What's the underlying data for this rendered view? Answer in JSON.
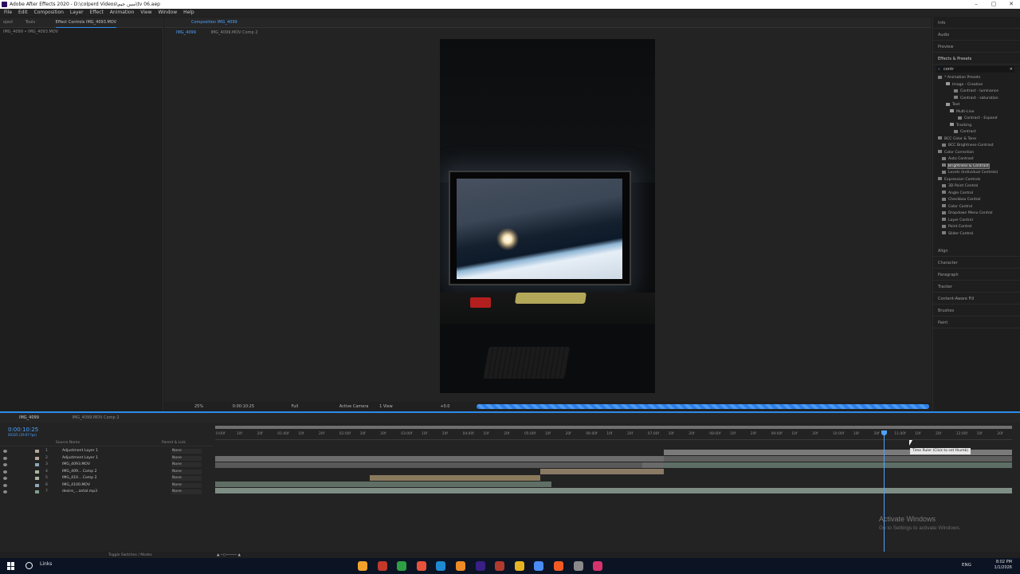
{
  "window": {
    "title": "Adobe After Effects 2020 - D:\\colperd Videos\\سين جيم\\tv 06.aep"
  },
  "menu": [
    "File",
    "Edit",
    "Composition",
    "Layer",
    "Effect",
    "Animation",
    "View",
    "Window",
    "Help"
  ],
  "left_panel": {
    "tabs": [
      "oject",
      "Tools",
      "Effect Controls IMG_4093.MOV"
    ],
    "subtitle": "IMG_4099 • IMG_4093.MOV"
  },
  "composition": {
    "tab": "Composition IMG_4099",
    "sub_tabs": [
      "IMG_4099",
      "IMG_4099.MOV Comp 2"
    ],
    "bottom": {
      "zoom": "25%",
      "time": "0:00:10:25",
      "resolution": "Full",
      "camera": "Active Camera",
      "view": "1 View",
      "exposure": "+0.0"
    }
  },
  "right_panel": {
    "panels_top": [
      "Info",
      "Audio",
      "Preview"
    ],
    "effects_title": "Effects & Presets",
    "search": "contr",
    "effects": [
      {
        "indent": 0,
        "label": "* Animation Presets",
        "folder": false
      },
      {
        "indent": 2,
        "label": "Image - Creative",
        "folder": true
      },
      {
        "indent": 4,
        "label": "Contrast - luminance",
        "folder": false
      },
      {
        "indent": 4,
        "label": "Contrast - saturation",
        "folder": false
      },
      {
        "indent": 2,
        "label": "Text",
        "folder": true
      },
      {
        "indent": 3,
        "label": "Multi-Line",
        "folder": true
      },
      {
        "indent": 5,
        "label": "Contract - Expand",
        "folder": false
      },
      {
        "indent": 3,
        "label": "Tracking",
        "folder": true
      },
      {
        "indent": 4,
        "label": "Contract",
        "folder": false
      },
      {
        "indent": 0,
        "label": "BCC Color & Tone",
        "folder": false
      },
      {
        "indent": 1,
        "label": "BCC Brightness-Contrast",
        "folder": false
      },
      {
        "indent": 0,
        "label": "Color Correction",
        "folder": false
      },
      {
        "indent": 1,
        "label": "Auto Contrast",
        "folder": false
      },
      {
        "indent": 1,
        "label": "Brightness & Contrast",
        "folder": false,
        "selected": true
      },
      {
        "indent": 1,
        "label": "Levels (Individual Controls)",
        "folder": false
      },
      {
        "indent": 0,
        "label": "Expression Controls",
        "folder": false
      },
      {
        "indent": 1,
        "label": "3D Point Control",
        "folder": false
      },
      {
        "indent": 1,
        "label": "Angle Control",
        "folder": false
      },
      {
        "indent": 1,
        "label": "Checkbox Control",
        "folder": false
      },
      {
        "indent": 1,
        "label": "Color Control",
        "folder": false
      },
      {
        "indent": 1,
        "label": "Dropdown Menu Control",
        "folder": false
      },
      {
        "indent": 1,
        "label": "Layer Control",
        "folder": false
      },
      {
        "indent": 1,
        "label": "Point Control",
        "folder": false
      },
      {
        "indent": 1,
        "label": "Slider Control",
        "folder": false
      }
    ],
    "panels_bottom": [
      "Align",
      "Character",
      "Paragraph",
      "Tracker",
      "Content-Aware Fill",
      "Brushes",
      "Paint"
    ]
  },
  "timeline": {
    "tabs": [
      "IMG_4099",
      "IMG_4099.MOV Comp 2"
    ],
    "timecode": "0:00:10:25",
    "timecode_sub": "00325 (29.97 fps)",
    "headers": {
      "source": "Source Name",
      "parent": "Parent & Link"
    },
    "layers": [
      {
        "num": "1",
        "name": "Adjustment Layer 1",
        "parent": "None"
      },
      {
        "num": "2",
        "name": "Adjustment Layer 1",
        "parent": "None"
      },
      {
        "num": "3",
        "name": "IMG_4093.MOV",
        "parent": "None"
      },
      {
        "num": "4",
        "name": "IMG_409... Comp 2",
        "parent": "None"
      },
      {
        "num": "5",
        "name": "IMG_410... Comp 2",
        "parent": "None"
      },
      {
        "num": "6",
        "name": "IMG_4100.MOV",
        "parent": "None"
      },
      {
        "num": "7",
        "name": "desire_...antal.mp3",
        "parent": "None"
      }
    ],
    "ruler_labels": [
      "0:00f",
      "10f",
      "20f",
      "01:00f",
      "10f",
      "20f",
      "02:00f",
      "10f",
      "20f",
      "03:00f",
      "10f",
      "20f",
      "04:00f",
      "10f",
      "20f",
      "05:00f",
      "10f",
      "20f",
      "06:00f",
      "10f",
      "20f",
      "07:00f",
      "10f",
      "20f",
      "08:00f",
      "10f",
      "20f",
      "09:00f",
      "10f",
      "20f",
      "10:00f",
      "10f",
      "20f",
      "11:00f",
      "10f",
      "20f",
      "12:00f",
      "10f",
      "20f"
    ],
    "tooltip": "Time Ruler (Click to set thumb)",
    "bottom_label": "Toggle Switches / Modes"
  },
  "watermark": {
    "line1": "Activate Windows",
    "line2": "Go to Settings to activate Windows."
  },
  "taskbar": {
    "links": "Links",
    "lang": "ENG",
    "time": "8:02 PM",
    "date": "1/1/2026"
  }
}
